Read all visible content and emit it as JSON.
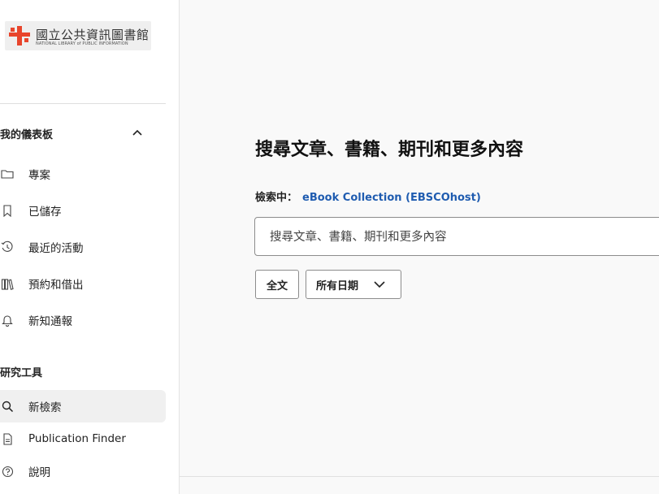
{
  "logo": {
    "name_cn": "國立公共資訊圖書館",
    "name_en": "NATIONAL LIBRARY of PUBLIC INFORMATION"
  },
  "sidebar": {
    "dashboard_header": "我的儀表板",
    "dashboard_items": [
      {
        "label": "專案",
        "icon": "folder-icon"
      },
      {
        "label": "已儲存",
        "icon": "bookmark-icon"
      },
      {
        "label": "最近的活動",
        "icon": "history-icon"
      },
      {
        "label": "預約和借出",
        "icon": "books-icon"
      },
      {
        "label": "新知通報",
        "icon": "bell-icon"
      }
    ],
    "tools_header": "研究工具",
    "tools_items": [
      {
        "label": "新檢索",
        "icon": "search-icon",
        "active": true
      },
      {
        "label": "Publication Finder",
        "icon": "document-icon"
      },
      {
        "label": "說明",
        "icon": "help-icon"
      }
    ]
  },
  "main": {
    "title": "搜尋文章、書籍、期刊和更多內容",
    "searching_label": "檢索中：",
    "database": "eBook Collection (EBSCOhost)",
    "search_placeholder": "搜尋文章、書籍、期刊和更多內容",
    "fulltext_label": "全文",
    "date_filter_label": "所有日期"
  },
  "colors": {
    "accent": "#1f5cb0",
    "logo_red": "#e8452c",
    "background": "#f9f9f9"
  }
}
